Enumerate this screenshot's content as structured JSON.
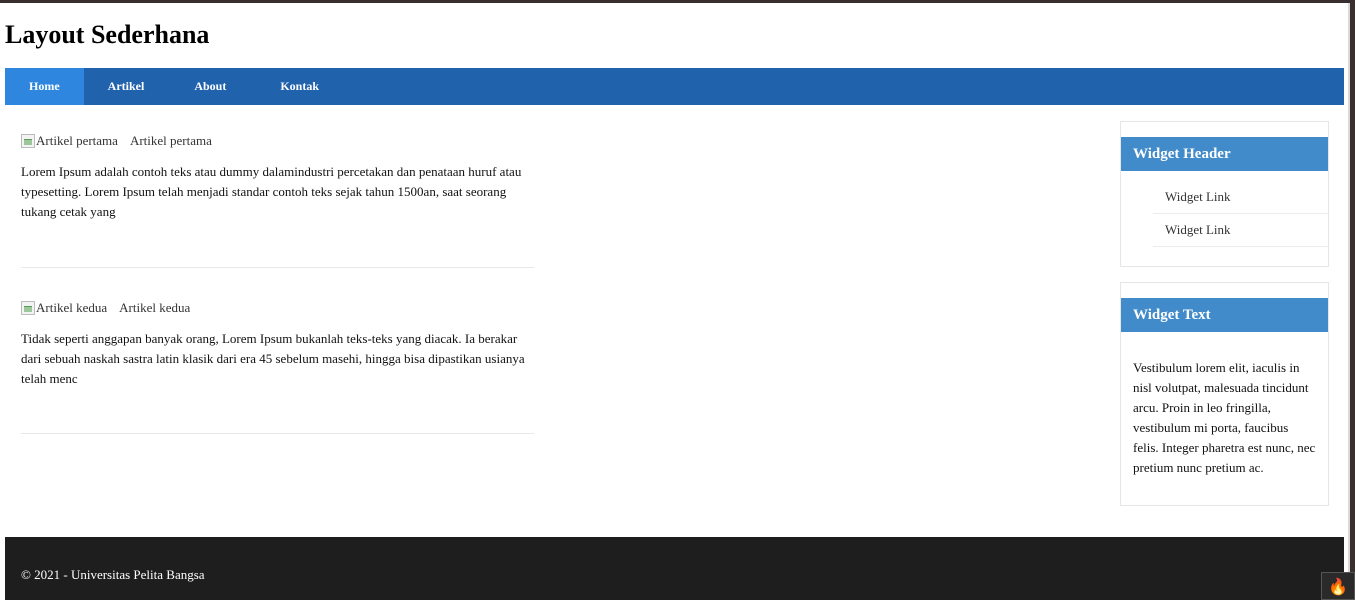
{
  "site": {
    "title": "Layout Sederhana"
  },
  "nav": {
    "items": [
      {
        "label": "Home"
      },
      {
        "label": "Artikel"
      },
      {
        "label": "About"
      },
      {
        "label": "Kontak"
      }
    ]
  },
  "articles": [
    {
      "img_alt": "Artikel pertama",
      "title": "Artikel pertama",
      "text": "Lorem Ipsum adalah contoh teks atau dummy dalamindustri percetakan dan penataan huruf atau typesetting. Lorem Ipsum telah menjadi standar contoh teks sejak tahun 1500an, saat seorang tukang cetak yang"
    },
    {
      "img_alt": "Artikel kedua",
      "title": "Artikel kedua",
      "text": "Tidak seperti anggapan banyak orang, Lorem Ipsum bukanlah teks-teks yang diacak. Ia berakar dari sebuah naskah sastra latin klasik dari era 45 sebelum masehi, hingga bisa dipastikan usianya telah menc"
    }
  ],
  "widgets": {
    "header_widget": {
      "title": "Widget Header",
      "links": [
        {
          "label": "Widget Link"
        },
        {
          "label": "Widget Link"
        }
      ]
    },
    "text_widget": {
      "title": "Widget Text",
      "body": "Vestibulum lorem elit, iaculis in nisl volutpat, malesuada tincidunt arcu. Proin in leo fringilla, vestibulum mi porta, faucibus felis. Integer pharetra est nunc, nec pretium nunc pretium ac."
    }
  },
  "footer": {
    "text": "© 2021 - Universitas Pelita Bangsa"
  },
  "corner_badge": {
    "icon": "flame-icon"
  },
  "colors": {
    "nav_bg": "#2162ac",
    "nav_active": "#2f86de",
    "widget_header": "#428bca",
    "footer_bg": "#1e1e1e"
  }
}
